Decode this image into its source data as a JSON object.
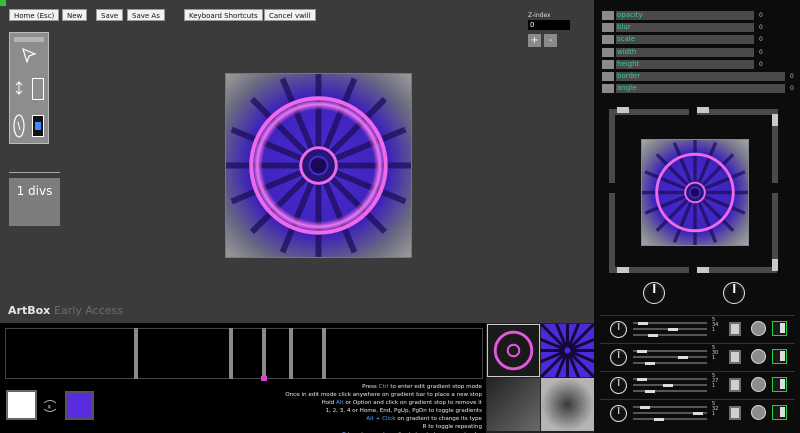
{
  "toolbar": {
    "home": "Home (Esc)",
    "new": "New",
    "save": "Save",
    "save_as": "Save As",
    "shortcuts": "Keyboard Shortcuts",
    "cancel": "Cancel vwill"
  },
  "zindex": {
    "label": "Z-index",
    "value": "0",
    "plus": "+",
    "minus": "-"
  },
  "layers": {
    "count_label": "1 divs"
  },
  "brand": {
    "name": "ArtBox",
    "suffix": "Early Access"
  },
  "properties": [
    {
      "name": "opacity",
      "value": "0"
    },
    {
      "name": "blur",
      "value": "0"
    },
    {
      "name": "scale",
      "value": "0"
    },
    {
      "name": "width",
      "value": "0"
    },
    {
      "name": "height",
      "value": "0"
    },
    {
      "name": "border",
      "value": "0"
    },
    {
      "name": "angle",
      "value": "0"
    }
  ],
  "gradient_rows": [
    {
      "nums": [
        "5",
        "34",
        "1"
      ]
    },
    {
      "nums": [
        "5",
        "30",
        "1"
      ]
    },
    {
      "nums": [
        "5",
        "27",
        "1"
      ]
    },
    {
      "nums": [
        "5",
        "32",
        "1"
      ]
    }
  ],
  "help_lines": [
    {
      "pre": "Press ",
      "key": "Ctrl",
      "post": " to enter edit gradient stop mode"
    },
    {
      "pre": "Once in edit mode click anywhere on gradient bar to place a new stop",
      "key": "",
      "post": ""
    },
    {
      "pre": "Hold ",
      "key": "Alt",
      "post": " or Option and click on gradient stop to remove it"
    },
    {
      "pre": "1, 2, 3, 4 or Home, End, PgUp, PgDn to toggle gradients",
      "key": "",
      "post": ""
    },
    {
      "pre": "",
      "key": "Alt + Click",
      "post": " on gradient to change its type"
    },
    {
      "pre": "R to toggle repeating",
      "key": "",
      "post": ""
    },
    {
      "pre": "",
      "key": "T",
      "post": " to set current gradient stop to transparent color"
    }
  ],
  "colors": {
    "accent": "#5a2be0",
    "pink": "#e040d8",
    "green": "#1fd13b",
    "teal": "#39c7a0"
  }
}
